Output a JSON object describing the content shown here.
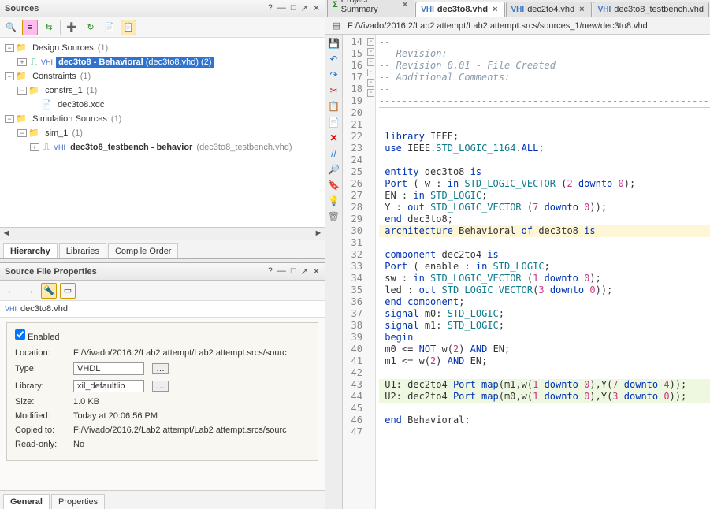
{
  "sources": {
    "title": "Sources",
    "tree": {
      "root1": "Design Sources",
      "root1_count": "(1)",
      "ds_file_prefix": "dec3to8 - Behavioral",
      "ds_file_suffix": "(dec3to8.vhd) (2)",
      "root2": "Constraints",
      "root2_count": "(1)",
      "constrs": "constrs_1",
      "constrs_count": "(1)",
      "xdc": "dec3to8.xdc",
      "root3": "Simulation Sources",
      "root3_count": "(1)",
      "sim": "sim_1",
      "sim_count": "(1)",
      "tb_prefix": "dec3to8_testbench - behavior",
      "tb_suffix": "(dec3to8_testbench.vhd)"
    },
    "tabs": {
      "t1": "Hierarchy",
      "t2": "Libraries",
      "t3": "Compile Order"
    }
  },
  "props": {
    "title": "Source File Properties",
    "file": "dec3to8.vhd",
    "enabled_label": "Enabled",
    "rows": {
      "location_k": "Location:",
      "location_v": "F:/Vivado/2016.2/Lab2 attempt/Lab2 attempt.srcs/sourc",
      "type_k": "Type:",
      "type_v": "VHDL",
      "library_k": "Library:",
      "library_v": "xil_defaultlib",
      "size_k": "Size:",
      "size_v": "1.0 KB",
      "modified_k": "Modified:",
      "modified_v": "Today at 20:06:56 PM",
      "copied_k": "Copied to:",
      "copied_v": "F:/Vivado/2016.2/Lab2 attempt/Lab2 attempt.srcs/sourc",
      "readonly_k": "Read-only:",
      "readonly_v": "No"
    },
    "tabs": {
      "t1": "General",
      "t2": "Properties"
    }
  },
  "editor": {
    "tabs": {
      "t1": "Project Summary",
      "t2": "dec3to8.vhd",
      "t3": "dec2to4.vhd",
      "t4": "dec3to8_testbench.vhd"
    },
    "path": "F:/Vivado/2016.2/Lab2 attempt/Lab2 attempt.srcs/sources_1/new/dec3to8.vhd",
    "first_line": 14,
    "lines": [
      {
        "n": 14,
        "t": "cmt",
        "tx": "--"
      },
      {
        "n": 15,
        "t": "cmt",
        "tx": "-- Revision:"
      },
      {
        "n": 16,
        "t": "cmt",
        "tx": "-- Revision 0.01 - File Created"
      },
      {
        "n": 17,
        "t": "cmt",
        "tx": "-- Additional Comments:"
      },
      {
        "n": 18,
        "t": "cmt",
        "tx": "--"
      },
      {
        "n": 19,
        "t": "rule",
        "tx": "----------------------------------------------------------"
      },
      {
        "n": 20,
        "t": "blank",
        "tx": ""
      },
      {
        "n": 21,
        "t": "blank",
        "tx": ""
      },
      {
        "n": 22,
        "t": "code",
        "seg": [
          {
            "c": "kw",
            "s": "library"
          },
          {
            "c": "id",
            "s": " IEEE;"
          }
        ]
      },
      {
        "n": 23,
        "t": "code",
        "seg": [
          {
            "c": "kw",
            "s": "use"
          },
          {
            "c": "id",
            "s": " IEEE."
          },
          {
            "c": "ty",
            "s": "STD_LOGIC_1164"
          },
          {
            "c": "id",
            "s": "."
          },
          {
            "c": "kw",
            "s": "ALL"
          },
          {
            "c": "id",
            "s": ";"
          }
        ]
      },
      {
        "n": 24,
        "t": "blank",
        "tx": ""
      },
      {
        "n": 25,
        "t": "code",
        "fold": "-",
        "seg": [
          {
            "c": "kw",
            "s": "entity"
          },
          {
            "c": "id",
            "s": " dec3to8 "
          },
          {
            "c": "kw",
            "s": "is"
          }
        ]
      },
      {
        "n": 26,
        "t": "code",
        "seg": [
          {
            "c": "kw",
            "s": "Port"
          },
          {
            "c": "id",
            "s": " ( w : "
          },
          {
            "c": "kw",
            "s": "in"
          },
          {
            "c": "id",
            "s": " "
          },
          {
            "c": "ty",
            "s": "STD_LOGIC_VECTOR"
          },
          {
            "c": "id",
            "s": " ("
          },
          {
            "c": "num",
            "s": "2"
          },
          {
            "c": "id",
            "s": " "
          },
          {
            "c": "kw",
            "s": "downto"
          },
          {
            "c": "id",
            "s": " "
          },
          {
            "c": "num",
            "s": "0"
          },
          {
            "c": "id",
            "s": ");"
          }
        ]
      },
      {
        "n": 27,
        "t": "code",
        "seg": [
          {
            "c": "id",
            "s": "EN : "
          },
          {
            "c": "kw",
            "s": "in"
          },
          {
            "c": "id",
            "s": " "
          },
          {
            "c": "ty",
            "s": "STD_LOGIC"
          },
          {
            "c": "id",
            "s": ";"
          }
        ]
      },
      {
        "n": 28,
        "t": "code",
        "seg": [
          {
            "c": "id",
            "s": "Y : "
          },
          {
            "c": "kw",
            "s": "out"
          },
          {
            "c": "id",
            "s": " "
          },
          {
            "c": "ty",
            "s": "STD_LOGIC_VECTOR"
          },
          {
            "c": "id",
            "s": " ("
          },
          {
            "c": "num",
            "s": "7"
          },
          {
            "c": "id",
            "s": " "
          },
          {
            "c": "kw",
            "s": "downto"
          },
          {
            "c": "id",
            "s": " "
          },
          {
            "c": "num",
            "s": "0"
          },
          {
            "c": "id",
            "s": "));"
          }
        ]
      },
      {
        "n": 29,
        "t": "code",
        "fold": "-",
        "seg": [
          {
            "c": "kw",
            "s": "end"
          },
          {
            "c": "id",
            "s": " dec3to8;"
          }
        ]
      },
      {
        "n": 30,
        "t": "code-hi-y",
        "fold": "-",
        "seg": [
          {
            "c": "kw",
            "s": "architecture"
          },
          {
            "c": "id",
            "s": " Behavioral "
          },
          {
            "c": "kw",
            "s": "of"
          },
          {
            "c": "id",
            "s": " dec3to8 "
          },
          {
            "c": "kw",
            "s": "is"
          }
        ]
      },
      {
        "n": 31,
        "t": "blank",
        "tx": ""
      },
      {
        "n": 32,
        "t": "code",
        "fold": "-",
        "seg": [
          {
            "c": "kw",
            "s": "component"
          },
          {
            "c": "id",
            "s": " dec2to4 "
          },
          {
            "c": "kw",
            "s": "is"
          }
        ]
      },
      {
        "n": 33,
        "t": "code",
        "seg": [
          {
            "c": "kw",
            "s": "Port"
          },
          {
            "c": "id",
            "s": " ( enable : "
          },
          {
            "c": "kw",
            "s": "in"
          },
          {
            "c": "id",
            "s": " "
          },
          {
            "c": "ty",
            "s": "STD_LOGIC"
          },
          {
            "c": "id",
            "s": ";"
          }
        ]
      },
      {
        "n": 34,
        "t": "code",
        "seg": [
          {
            "c": "id",
            "s": "sw : "
          },
          {
            "c": "kw",
            "s": "in"
          },
          {
            "c": "id",
            "s": " "
          },
          {
            "c": "ty",
            "s": "STD_LOGIC_VECTOR"
          },
          {
            "c": "id",
            "s": " ("
          },
          {
            "c": "num",
            "s": "1"
          },
          {
            "c": "id",
            "s": " "
          },
          {
            "c": "kw",
            "s": "downto"
          },
          {
            "c": "id",
            "s": " "
          },
          {
            "c": "num",
            "s": "0"
          },
          {
            "c": "id",
            "s": ");"
          }
        ]
      },
      {
        "n": 35,
        "t": "code",
        "seg": [
          {
            "c": "id",
            "s": "led : "
          },
          {
            "c": "kw",
            "s": "out"
          },
          {
            "c": "id",
            "s": " "
          },
          {
            "c": "ty",
            "s": "STD_LOGIC_VECTOR"
          },
          {
            "c": "id",
            "s": "("
          },
          {
            "c": "num",
            "s": "3"
          },
          {
            "c": "id",
            "s": " "
          },
          {
            "c": "kw",
            "s": "downto"
          },
          {
            "c": "id",
            "s": " "
          },
          {
            "c": "num",
            "s": "0"
          },
          {
            "c": "id",
            "s": "));"
          }
        ]
      },
      {
        "n": 36,
        "t": "code",
        "fold": "-",
        "seg": [
          {
            "c": "kw",
            "s": "end"
          },
          {
            "c": "id",
            "s": " "
          },
          {
            "c": "kw",
            "s": "component"
          },
          {
            "c": "id",
            "s": ";"
          }
        ]
      },
      {
        "n": 37,
        "t": "code",
        "seg": [
          {
            "c": "kw",
            "s": "signal"
          },
          {
            "c": "id",
            "s": " m0: "
          },
          {
            "c": "ty",
            "s": "STD_LOGIC"
          },
          {
            "c": "id",
            "s": ";"
          }
        ]
      },
      {
        "n": 38,
        "t": "code",
        "seg": [
          {
            "c": "kw",
            "s": "signal"
          },
          {
            "c": "id",
            "s": " m1: "
          },
          {
            "c": "ty",
            "s": "STD_LOGIC"
          },
          {
            "c": "id",
            "s": ";"
          }
        ]
      },
      {
        "n": 39,
        "t": "code",
        "seg": [
          {
            "c": "kw",
            "s": "begin"
          }
        ]
      },
      {
        "n": 40,
        "t": "code",
        "seg": [
          {
            "c": "id",
            "s": "m0 <= "
          },
          {
            "c": "kw",
            "s": "NOT"
          },
          {
            "c": "id",
            "s": " w("
          },
          {
            "c": "num",
            "s": "2"
          },
          {
            "c": "id",
            "s": ") "
          },
          {
            "c": "kw",
            "s": "AND"
          },
          {
            "c": "id",
            "s": " EN;"
          }
        ]
      },
      {
        "n": 41,
        "t": "code",
        "seg": [
          {
            "c": "id",
            "s": "m1 <= w("
          },
          {
            "c": "num",
            "s": "2"
          },
          {
            "c": "id",
            "s": ") "
          },
          {
            "c": "kw",
            "s": "AND"
          },
          {
            "c": "id",
            "s": " EN;"
          }
        ]
      },
      {
        "n": 42,
        "t": "blank",
        "tx": ""
      },
      {
        "n": 43,
        "t": "code-hi-g",
        "seg": [
          {
            "c": "id",
            "s": "U1: dec2to4 "
          },
          {
            "c": "kw",
            "s": "Port map"
          },
          {
            "c": "id",
            "s": "(m1,w("
          },
          {
            "c": "num",
            "s": "1"
          },
          {
            "c": "id",
            "s": " "
          },
          {
            "c": "kw",
            "s": "downto"
          },
          {
            "c": "id",
            "s": " "
          },
          {
            "c": "num",
            "s": "0"
          },
          {
            "c": "id",
            "s": "),Y("
          },
          {
            "c": "num",
            "s": "7"
          },
          {
            "c": "id",
            "s": " "
          },
          {
            "c": "kw",
            "s": "downto"
          },
          {
            "c": "id",
            "s": " "
          },
          {
            "c": "num",
            "s": "4"
          },
          {
            "c": "id",
            "s": "));"
          }
        ]
      },
      {
        "n": 44,
        "t": "code-hi-g",
        "seg": [
          {
            "c": "id",
            "s": "U2: dec2to4 "
          },
          {
            "c": "kw",
            "s": "Port map"
          },
          {
            "c": "id",
            "s": "(m0,w("
          },
          {
            "c": "num",
            "s": "1"
          },
          {
            "c": "id",
            "s": " "
          },
          {
            "c": "kw",
            "s": "downto"
          },
          {
            "c": "id",
            "s": " "
          },
          {
            "c": "num",
            "s": "0"
          },
          {
            "c": "id",
            "s": "),Y("
          },
          {
            "c": "num",
            "s": "3"
          },
          {
            "c": "id",
            "s": " "
          },
          {
            "c": "kw",
            "s": "downto"
          },
          {
            "c": "id",
            "s": " "
          },
          {
            "c": "num",
            "s": "0"
          },
          {
            "c": "id",
            "s": "));"
          }
        ]
      },
      {
        "n": 45,
        "t": "blank",
        "tx": ""
      },
      {
        "n": 46,
        "t": "code",
        "fold": "-",
        "seg": [
          {
            "c": "kw",
            "s": "end"
          },
          {
            "c": "id",
            "s": " Behavioral;"
          }
        ]
      },
      {
        "n": 47,
        "t": "blank",
        "tx": ""
      }
    ]
  }
}
